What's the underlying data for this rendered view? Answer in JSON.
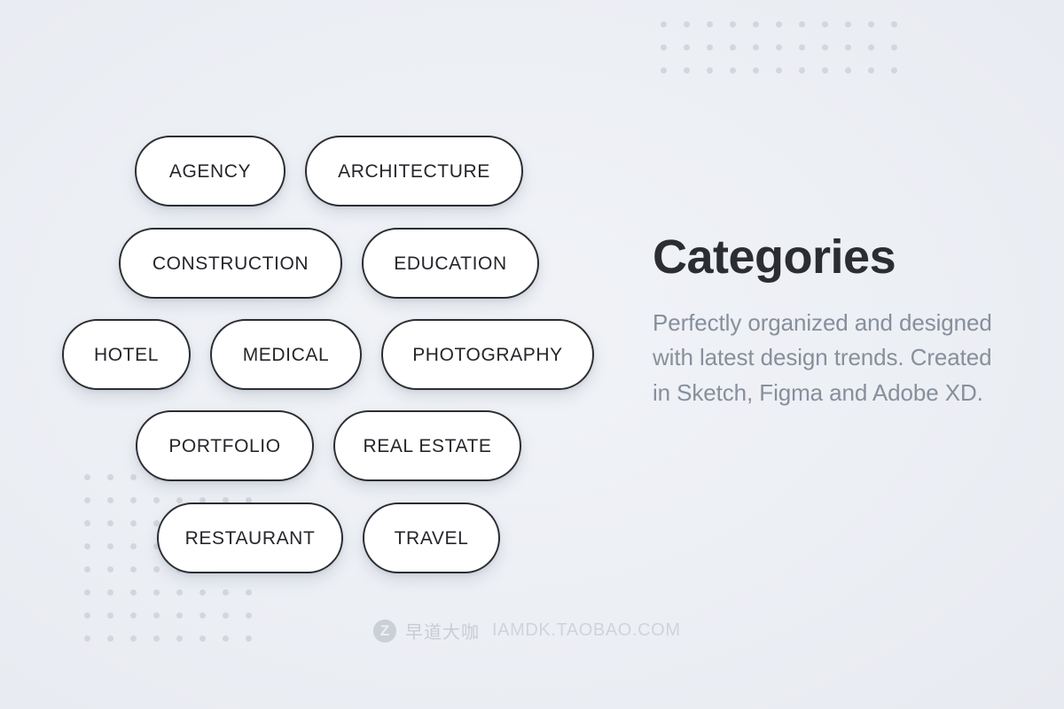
{
  "background": {
    "color": "#eceff4",
    "accent_dot_color": "#d2d7de"
  },
  "decorations": {
    "top_right_dots": {
      "columns": 11,
      "rows": 3
    },
    "bottom_left_dots": {
      "columns": 8,
      "rows": 8
    }
  },
  "info": {
    "title": "Categories",
    "description": "Perfectly organized and designed with latest design trends. Created in Sketch, Figma and Adobe XD.",
    "title_color": "#2b2d31",
    "description_color": "#878f9c"
  },
  "pills": {
    "border_color": "#2b2d31",
    "fill_color": "#ffffff",
    "label_color": "#24262a",
    "rows": [
      {
        "items": [
          {
            "label": "AGENCY"
          },
          {
            "label": "ARCHITECTURE"
          }
        ]
      },
      {
        "items": [
          {
            "label": "CONSTRUCTION"
          },
          {
            "label": "EDUCATION"
          }
        ]
      },
      {
        "items": [
          {
            "label": "HOTEL"
          },
          {
            "label": "MEDICAL"
          },
          {
            "label": "PHOTOGRAPHY"
          }
        ]
      },
      {
        "items": [
          {
            "label": "PORTFOLIO"
          },
          {
            "label": "REAL ESTATE"
          }
        ]
      },
      {
        "items": [
          {
            "label": "RESTAURANT"
          },
          {
            "label": "TRAVEL"
          }
        ]
      }
    ]
  },
  "watermark": {
    "logo_glyph": "Z",
    "logo_icon_name": "z-circle-logo-icon",
    "brand": "早道大咖",
    "url": "IAMDK.TAOBAO.COM",
    "color": "#c6cad1"
  }
}
